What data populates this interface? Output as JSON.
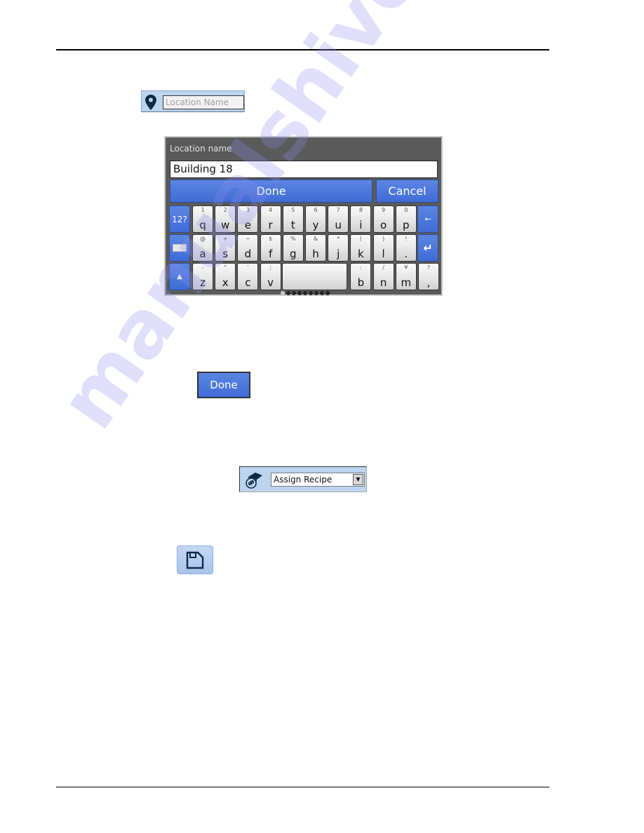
{
  "location_field": {
    "placeholder": "Location Name",
    "icon": "map-pin-icon"
  },
  "keyboard_dialog": {
    "title": "Location name",
    "input_value": "Building 18",
    "done_label": "Done",
    "cancel_label": "Cancel",
    "numeric_toggle_label": "12?",
    "rows": [
      [
        {
          "main": "q",
          "sub": "1"
        },
        {
          "main": "w",
          "sub": "2"
        },
        {
          "main": "e",
          "sub": "3"
        },
        {
          "main": "r",
          "sub": "4"
        },
        {
          "main": "t",
          "sub": "5"
        },
        {
          "main": "y",
          "sub": "6"
        },
        {
          "main": "u",
          "sub": "7"
        },
        {
          "main": "i",
          "sub": "8"
        },
        {
          "main": "o",
          "sub": "9"
        },
        {
          "main": "p",
          "sub": "0"
        }
      ],
      [
        {
          "main": "a",
          "sub": "@"
        },
        {
          "main": "s",
          "sub": "+"
        },
        {
          "main": "d",
          "sub": "−"
        },
        {
          "main": "f",
          "sub": "$"
        },
        {
          "main": "g",
          "sub": "%"
        },
        {
          "main": "h",
          "sub": "&"
        },
        {
          "main": "j",
          "sub": "*"
        },
        {
          "main": "k",
          "sub": "("
        },
        {
          "main": "l",
          "sub": ")"
        },
        {
          "main": ".",
          "sub": "!"
        }
      ],
      [
        {
          "main": "z",
          "sub": "-"
        },
        {
          "main": "x",
          "sub": "\""
        },
        {
          "main": "c",
          "sub": "'"
        },
        {
          "main": "v",
          "sub": ";"
        },
        {
          "main": "b",
          "sub": ":"
        },
        {
          "main": "n",
          "sub": "/"
        },
        {
          "main": "m",
          "sub": "¥"
        },
        {
          "main": ",",
          "sub": "?"
        }
      ]
    ],
    "page_indicator": {
      "total": 9,
      "active": 1
    }
  },
  "done_button": {
    "label": "Done"
  },
  "assign_recipe": {
    "selected": "Assign Recipe",
    "icon": "recipe-link-icon"
  },
  "save_button": {
    "icon": "floppy-disk-icon"
  },
  "watermark": "manualshive.com"
}
